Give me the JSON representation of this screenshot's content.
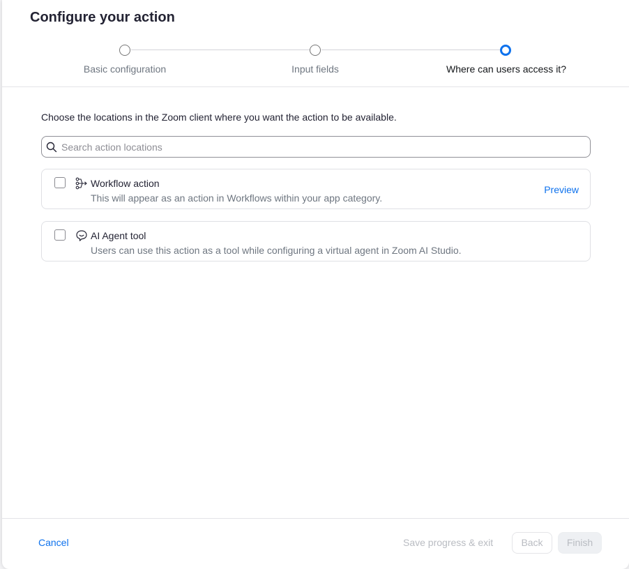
{
  "modal": {
    "title": "Configure your action"
  },
  "steps": [
    {
      "label": "Basic configuration",
      "state": "completed"
    },
    {
      "label": "Input fields",
      "state": "completed"
    },
    {
      "label": "Where can users access it?",
      "state": "active"
    }
  ],
  "instruction": "Choose the locations in the Zoom client where you want the action to be available.",
  "search": {
    "placeholder": "Search action locations",
    "value": "",
    "icon": "search-icon"
  },
  "locations": [
    {
      "icon": "workflow-icon",
      "title": "Workflow action",
      "description": "This will appear as an action in Workflows within your app category.",
      "checked": false,
      "link": "Preview"
    },
    {
      "icon": "ai-agent-icon",
      "title": "AI Agent tool",
      "description": "Users can use this action as a tool while configuring a virtual agent in Zoom AI Studio.",
      "checked": false
    }
  ],
  "footer": {
    "cancel": "Cancel",
    "save_exit": "Save progress & exit",
    "back": "Back",
    "finish": "Finish"
  },
  "colors": {
    "accent": "#0e72ed",
    "disabled_text": "#b9bcc2",
    "muted_text": "#6e7680"
  }
}
